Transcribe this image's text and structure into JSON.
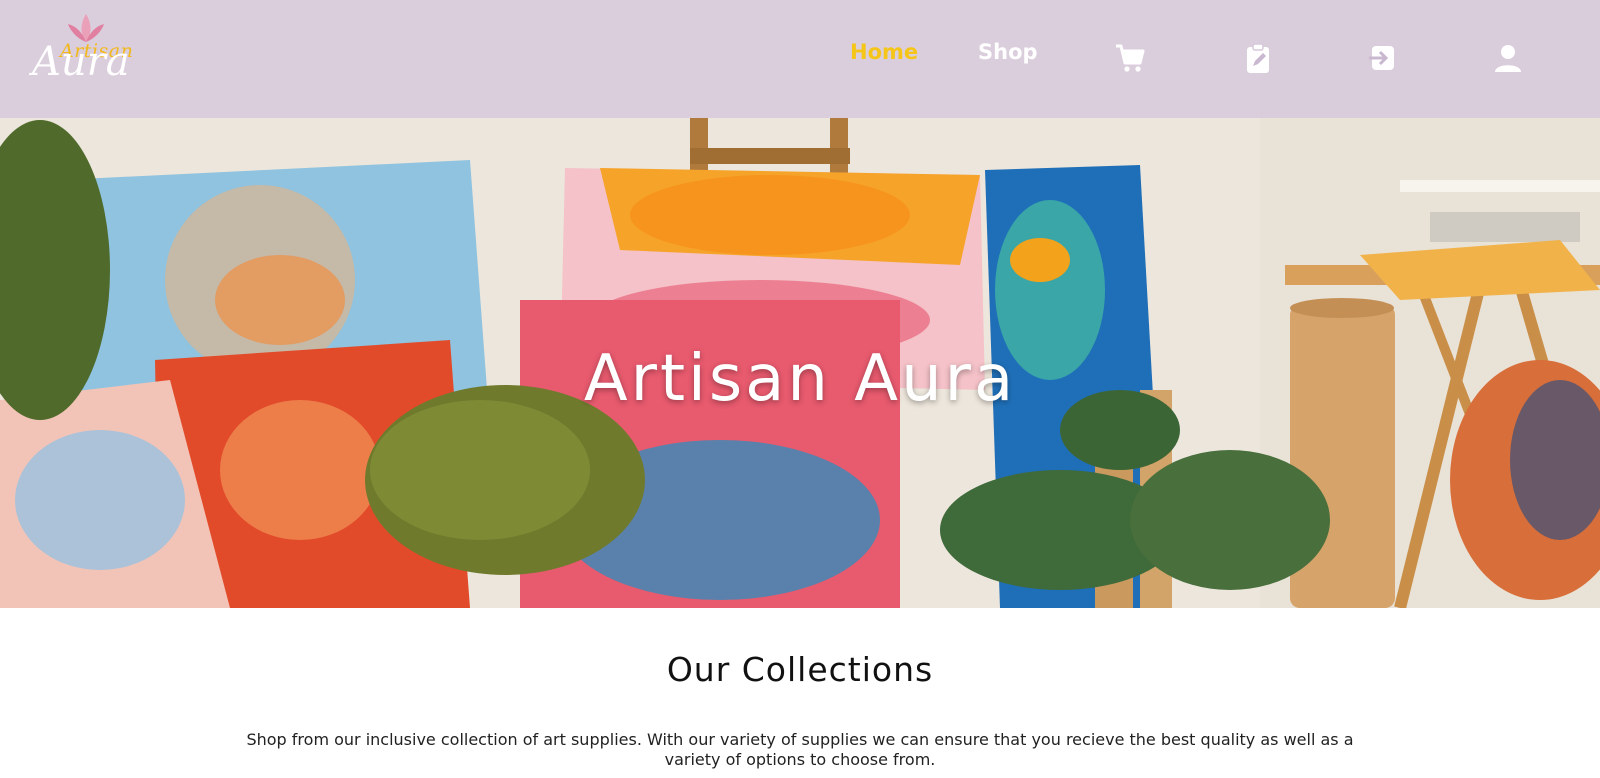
{
  "brand": {
    "logo_top": "Artisan",
    "logo_bottom": "Aura",
    "colors": {
      "accent": "#f5c518",
      "nav_bg": "#d7c8dc",
      "text_dark": "#111111"
    }
  },
  "nav": {
    "links": [
      {
        "label": "Home",
        "active": true
      },
      {
        "label": "Shop",
        "active": false
      }
    ],
    "icons": [
      "cart-icon",
      "clipboard-icon",
      "login-icon",
      "user-icon"
    ]
  },
  "hero": {
    "title": "Artisan Aura"
  },
  "collections": {
    "heading": "Our Collections",
    "description": "Shop from our inclusive collection of art supplies. With our variety of supplies we can ensure that you recieve the best quality as well as a variety of options to choose from."
  }
}
